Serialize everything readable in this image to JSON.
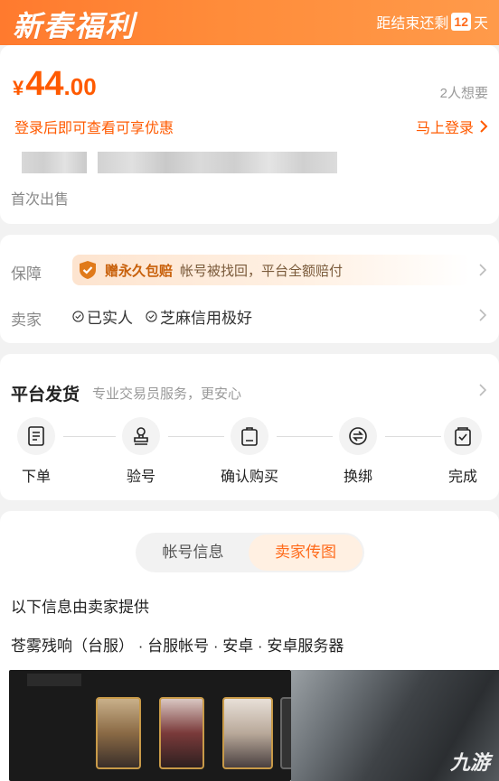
{
  "banner": {
    "title": "新春福利",
    "countdown_prefix": "距结束还剩",
    "days": "12",
    "days_suffix": "天"
  },
  "price": {
    "currency": "¥",
    "integer": "44",
    "decimal": ".00",
    "want_count": "2人想要"
  },
  "login": {
    "tip": "登录后即可查看可享优惠",
    "link": "马上登录"
  },
  "listing": {
    "first_sale": "首次出售"
  },
  "guarantee": {
    "label": "保障",
    "badge": "赠永久包赔",
    "text": "帐号被找回，平台全额赔付"
  },
  "seller": {
    "label": "卖家",
    "tags": [
      "已实人",
      "芝麻信用极好"
    ]
  },
  "shipping": {
    "title": "平台发货",
    "subtitle": "专业交易员服务，更安心",
    "steps": [
      {
        "label": "下单",
        "icon": "order-icon"
      },
      {
        "label": "验号",
        "icon": "stamp-icon"
      },
      {
        "label": "确认购买",
        "icon": "clipboard-icon"
      },
      {
        "label": "换绑",
        "icon": "exchange-icon"
      },
      {
        "label": "完成",
        "icon": "check-bag-icon"
      }
    ]
  },
  "tabs": [
    {
      "label": "帐号信息",
      "active": false
    },
    {
      "label": "卖家传图",
      "active": true
    }
  ],
  "details": {
    "provided_by": "以下信息由卖家提供",
    "game_info": "苍雾残响（台服） · 台服帐号 · 安卓 · 安卓服务器"
  },
  "watermark": "九游",
  "colors": {
    "accent": "#ff5a00",
    "banner": "#ff8c3a"
  }
}
